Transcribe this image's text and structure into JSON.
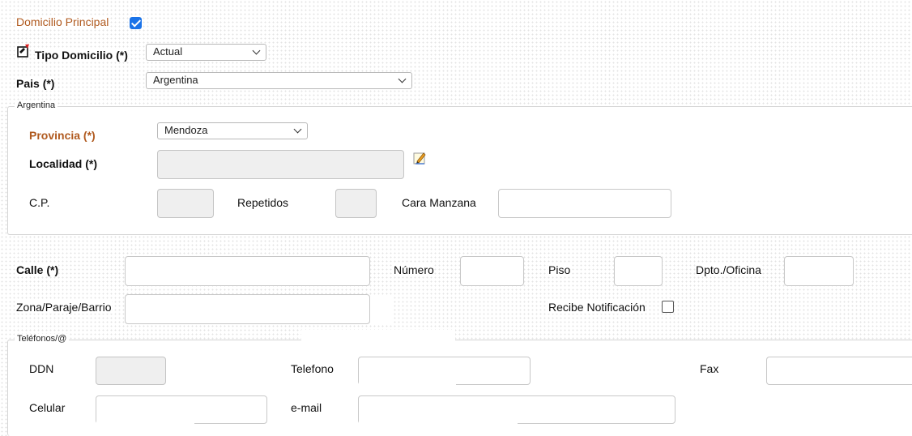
{
  "domicilio": {
    "principal_label": "Domicilio Principal",
    "principal_checked": true,
    "tipo_label": "Tipo Domicilio (*)",
    "tipo_value": "Actual",
    "pais_label": "Pais (*)",
    "pais_value": "Argentina"
  },
  "region": {
    "legend": "Argentina",
    "provincia_label": "Provincia (*)",
    "provincia_value": "Mendoza",
    "localidad_label": "Localidad (*)",
    "localidad_value": "",
    "cp_label": "C.P.",
    "cp_value": "",
    "repetidos_label": "Repetidos",
    "repetidos_value": "",
    "cara_manzana_label": "Cara Manzana",
    "cara_manzana_value": ""
  },
  "direccion": {
    "calle_label": "Calle (*)",
    "calle_value": "",
    "numero_label": "Número",
    "numero_value": "",
    "piso_label": "Piso",
    "piso_value": "",
    "dpto_label": "Dpto./Oficina",
    "dpto_value": "",
    "zona_label": "Zona/Paraje/Barrio",
    "zona_value": "",
    "recibe_label": "Recibe Notificación",
    "recibe_checked": false
  },
  "telefonos": {
    "legend": "Teléfonos/@",
    "ddn_label": "DDN",
    "ddn_value": "",
    "telefono_label": "Telefono",
    "telefono_value": "",
    "fax_label": "Fax",
    "fax_value": "",
    "celular_label": "Celular",
    "celular_value": "",
    "email_label": "e-mail",
    "email_value": ""
  },
  "icons": {
    "tipo_icon": "new-note-icon",
    "localidad_icon": "edit-pencil-icon"
  },
  "colors": {
    "accent_orange": "#b05a1f",
    "checkbox_blue": "#1b73e8"
  }
}
